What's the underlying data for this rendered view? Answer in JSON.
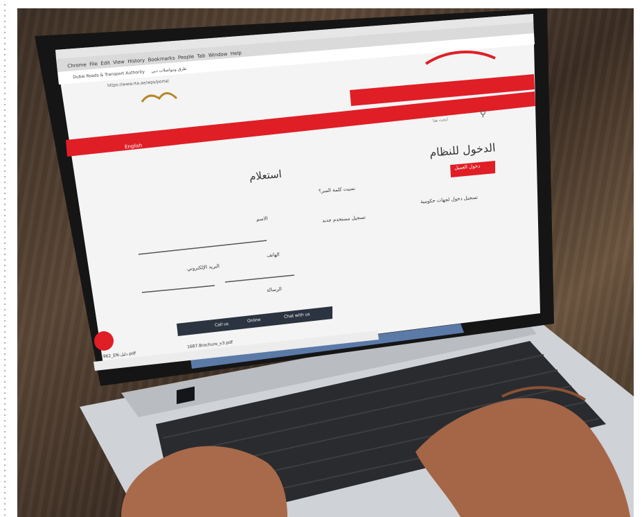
{
  "browser": {
    "menu_items": [
      "Chrome",
      "File",
      "Edit",
      "View",
      "History",
      "Bookmarks",
      "People",
      "Tab",
      "Window",
      "Help"
    ],
    "tabs": [
      "Dubai Roads & Transport Authority",
      "طرق ومواصلات دبي"
    ],
    "address": "https://www.rta.ae/wps/portal"
  },
  "site": {
    "login_title": "الدخول للنظام",
    "login_button": "دخول العميل",
    "forgot_password": "نسيت كلمة السر؟",
    "register_link": "تسجيل مستخدم جديد",
    "gov_link": "تسجيل دخول لجهات حكومية",
    "search_placeholder": "ابحث هنا",
    "language_link": "English",
    "inquiry_title": "استعلام",
    "field_name": "الاسم",
    "field_phone": "الهاتف",
    "field_email": "البريد الإلكتروني",
    "field_message": "الرسالة"
  },
  "contact_bar": {
    "call_label": "Call us",
    "online_label": "Online",
    "chat_label": "Chat with us"
  },
  "taskbar": {
    "downloads": [
      "1687.Brochure_v3.pdf",
      "1962_EN-دليل.pdf"
    ]
  },
  "colors": {
    "brand_red": "#e01e26",
    "laptop_silver": "#c9ccd0",
    "keyboard_key": "#1c1d20"
  }
}
